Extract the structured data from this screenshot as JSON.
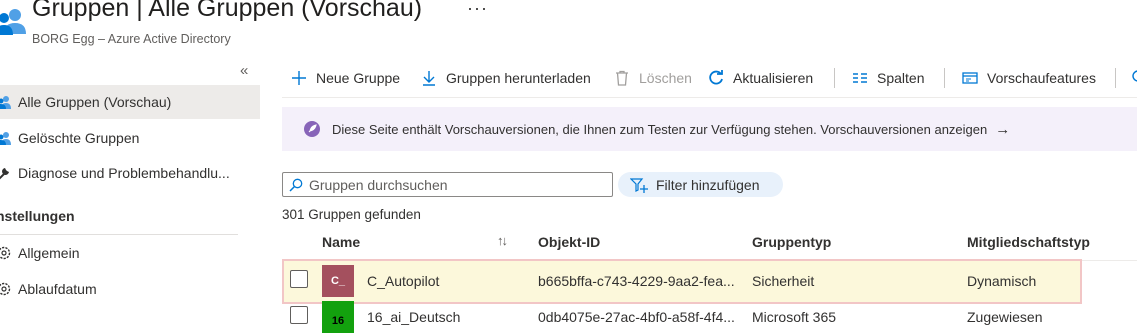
{
  "header": {
    "title": "Gruppen | Alle Gruppen (Vorschau)",
    "subtitle": "BORG Egg – Azure Active Directory",
    "more": "···",
    "icon": "groups-icon"
  },
  "sidebar": {
    "collapse": "«",
    "items": [
      {
        "label": "Alle Gruppen (Vorschau)",
        "icon": "groups-icon",
        "selected": true
      },
      {
        "label": "Gelöschte Gruppen",
        "icon": "deleted-groups-icon"
      },
      {
        "label": "Diagnose und Problembehandlu...",
        "icon": "wrench-icon"
      }
    ],
    "section": "nstellungen",
    "settings": [
      {
        "label": "Allgemein",
        "icon": "gear-icon"
      },
      {
        "label": "Ablaufdatum",
        "icon": "gear-icon"
      }
    ]
  },
  "toolbar": {
    "new_group": "Neue Gruppe",
    "download": "Gruppen herunterladen",
    "delete": "Löschen",
    "refresh": "Aktualisieren",
    "columns": "Spalten",
    "preview_features": "Vorschaufeatures"
  },
  "banner": {
    "text": "Diese Seite enthält Vorschauversionen, die Ihnen zum Testen zur Verfügung stehen. Vorschauversionen anzeigen",
    "arrow": "→",
    "color": "#f4f0fa"
  },
  "search": {
    "placeholder": "Gruppen durchsuchen",
    "value": ""
  },
  "filter": {
    "label": "Filter hinzufügen"
  },
  "result_count": "301 Gruppen gefunden",
  "table": {
    "columns": [
      "Name",
      "Objekt-ID",
      "Gruppentyp",
      "Mitgliedschaftstyp"
    ],
    "sort_icon": "↑↓",
    "rows": [
      {
        "avatar": "C_",
        "avatar_color": "#a4505e",
        "name": "C_Autopilot",
        "object_id": "b665bffa-c743-4229-9aa2-fea...",
        "type": "Sicherheit",
        "membership": "Dynamisch"
      },
      {
        "avatar": "16",
        "avatar_color": "#13a10e",
        "name": "16_ai_Deutsch",
        "object_id": "0db4075e-27ac-4bf0-a58f-4f4...",
        "type": "Microsoft 365",
        "membership": "Zugewiesen"
      }
    ]
  },
  "colors": {
    "accent": "#0078d4",
    "selected_row": "#fcf8db",
    "selected_border": "#f2c6c6"
  }
}
